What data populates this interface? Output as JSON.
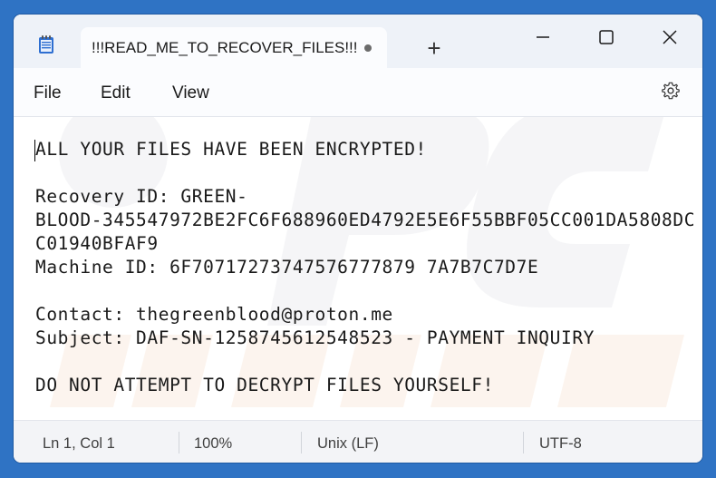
{
  "tab": {
    "title": "!!!READ_ME_TO_RECOVER_FILES!!!",
    "new_tab": "+"
  },
  "menu": {
    "file": "File",
    "edit": "Edit",
    "view": "View"
  },
  "document": {
    "lines": [
      "ALL YOUR FILES HAVE BEEN ENCRYPTED!",
      "",
      "Recovery ID: GREEN-",
      "BLOOD-345547972BE2FC6F688960ED4792E5E6F55BBF05CC001DA5808DC",
      "C01940BFAF9",
      "Machine ID: 6F70717273747576777879 7A7B7C7D7E",
      "",
      "Contact: thegreenblood@proton.me",
      "Subject: DAF-SN-1258745612548523 - PAYMENT INQUIRY",
      "",
      "DO NOT ATTEMPT TO DECRYPT FILES YOURSELF!"
    ]
  },
  "status": {
    "position": "Ln 1, Col 1",
    "zoom": "100%",
    "line_ending": "Unix (LF)",
    "encoding": "UTF-8"
  },
  "colors": {
    "desktop": "#2f73c4",
    "titlebar": "#eef2f8",
    "notepad_icon": "#2e6fd1"
  },
  "icons": [
    "notepad-icon",
    "unsaved-dot-icon",
    "minimize-icon",
    "maximize-icon",
    "close-icon",
    "gear-icon"
  ]
}
